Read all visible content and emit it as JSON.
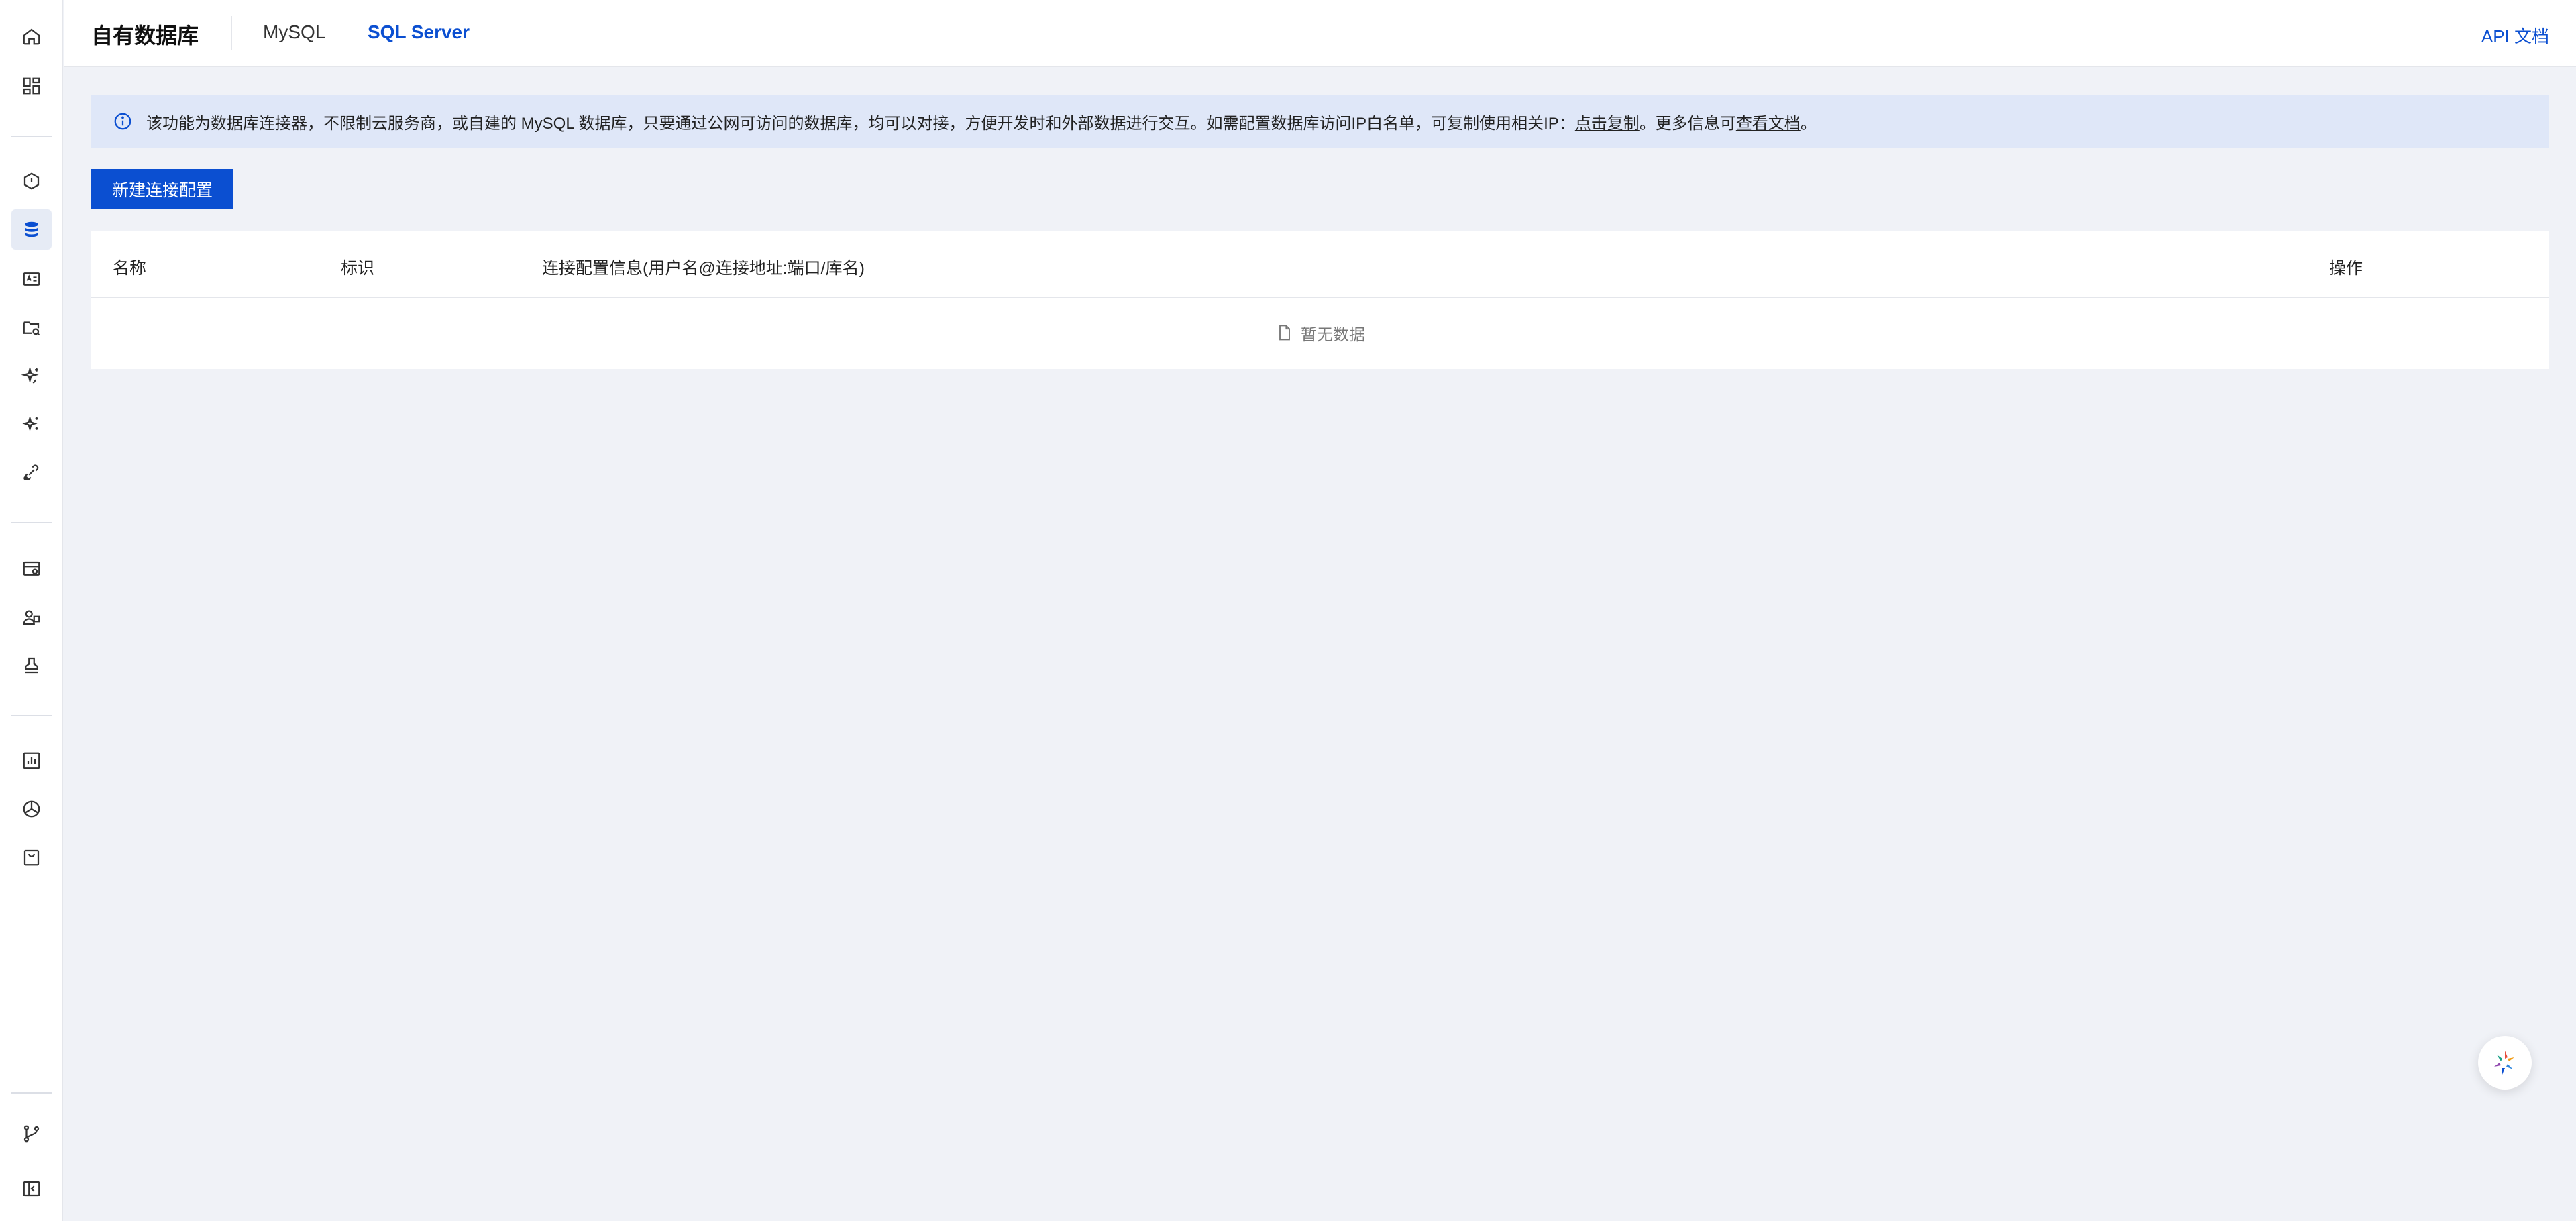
{
  "header": {
    "title": "自有数据库",
    "tabs": [
      {
        "label": "MySQL"
      },
      {
        "label": "SQL Server"
      }
    ],
    "api_link": "API 文档"
  },
  "banner": {
    "text_main": "该功能为数据库连接器，不限制云服务商，或自建的 MySQL 数据库，只要通过公网可访问的数据库，均可以对接，方便开发时和外部数据进行交互。如需配置数据库访问IP白名单，可复制使用相关IP：",
    "copy_link": "点击复制",
    "text_more": "。更多信息可",
    "doc_link": "查看文档",
    "text_end": "。"
  },
  "toolbar": {
    "new_button": "新建连接配置"
  },
  "table": {
    "columns": [
      "名称",
      "标识",
      "连接配置信息(用户名@连接地址:端口/库名)",
      "操作"
    ],
    "empty_text": "暂无数据"
  },
  "colors": {
    "accent": "#0b4fd1",
    "banner_bg": "#dfe7f8",
    "page_bg": "#f0f2f7"
  },
  "icons": {
    "sidebar": [
      "home-icon",
      "apps-icon",
      "shield-icon",
      "database-icon",
      "id-card-icon",
      "folder-search-icon",
      "sparkle-icon",
      "magic-icon",
      "link-icon",
      "monitor-icon",
      "users-icon",
      "stamp-icon",
      "chart-icon",
      "cube-icon",
      "bag-icon",
      "git-branch-icon",
      "collapse-icon"
    ]
  }
}
